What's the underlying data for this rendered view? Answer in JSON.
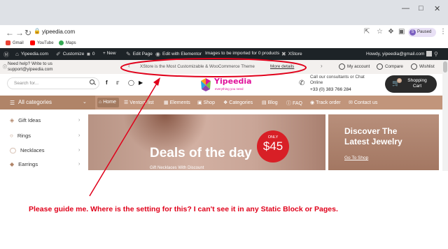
{
  "browser": {
    "url": "yipeedia.com",
    "profile_status": "Paused",
    "profile_initial": "S",
    "bookmarks": [
      "Gmail",
      "YouTube",
      "Maps"
    ]
  },
  "wp_admin_bar": {
    "site": "Yipeedia.com",
    "customize": "Customize",
    "comments": "0",
    "new": "+ New",
    "edit_page": "Edit Page",
    "elementor": "Edit with Elementor",
    "import": "Images to be imported for 0 products",
    "xstore": "XStore",
    "howdy": "Howdy, yipeedia@gmail.com"
  },
  "topbar": {
    "help_line1": "Need help? Write to us",
    "help_line2": "support@yipeedia.com",
    "promo_text": "XStore is the Most Customizable & WooCommerce Theme",
    "promo_link": "More details",
    "account": "My account",
    "compare": "Compare",
    "wishlist": "Wishlist"
  },
  "header": {
    "search_placeholder": "Search for...",
    "logo": "Yipeedia",
    "logo_tagline": "everything you need",
    "consult_line1": "Call our consultants or Chat",
    "consult_line2": "Online",
    "phone": "+33 (0) 383 766 284",
    "cart_line1": "Shopping",
    "cart_line2": "Cart",
    "cart_count": "0"
  },
  "nav": {
    "all_categories": "All categories",
    "items": [
      "Home",
      "Ventors list",
      "Elements",
      "Shop",
      "Categories",
      "Blog",
      "FAQ",
      "Track order",
      "Contact us"
    ]
  },
  "categories": [
    "Gift Ideas",
    "Rings",
    "Necklaces",
    "Earrings"
  ],
  "hero": {
    "title": "Deals of the day",
    "subtitle": "Gift Necklaces With Discount",
    "badge_label": "ONLY",
    "badge_price": "$45"
  },
  "promo_card": {
    "title_line1": "Discover The",
    "title_line2": "Latest Jewelry",
    "link": "Go To Shop"
  },
  "annotation": {
    "question": "Please guide me. Where is the setting for this? I can't see it in any Static Block or Pages.",
    "color": "#e0001a"
  },
  "colors": {
    "nav_bg": "#c1957b",
    "logo": "#e0119a",
    "badge": "#d81f26",
    "wp_bar": "#1d2327"
  }
}
